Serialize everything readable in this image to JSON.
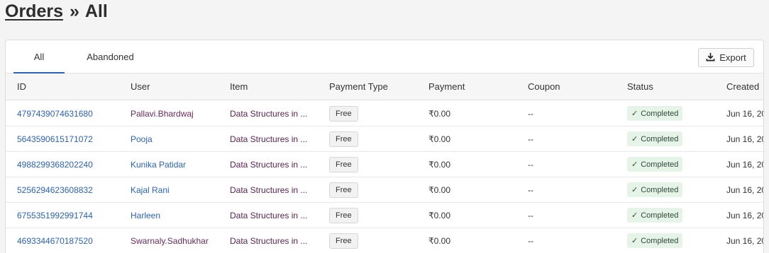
{
  "breadcrumb": {
    "parent": "Orders",
    "separator": "»",
    "current": "All"
  },
  "tabs": [
    {
      "label": "All",
      "active": true
    },
    {
      "label": "Abandoned",
      "active": false
    }
  ],
  "toolbar": {
    "export_label": "Export",
    "export_icon": "download-icon"
  },
  "columns": [
    "ID",
    "User",
    "Item",
    "Payment Type",
    "Payment",
    "Coupon",
    "Status",
    "Created"
  ],
  "rows": [
    {
      "id": "4797439074631680",
      "user": "Pallavi.Bhardwaj",
      "item": "Data Structures in ...",
      "payment_type": "Free",
      "payment": "₹0.00",
      "coupon": "--",
      "status": "Completed",
      "created": "Jun 16, 20"
    },
    {
      "id": "5643590615171072",
      "user": "Pooja",
      "item": "Data Structures in ...",
      "payment_type": "Free",
      "payment": "₹0.00",
      "coupon": "--",
      "status": "Completed",
      "created": "Jun 16, 20"
    },
    {
      "id": "4988299368202240",
      "user": "Kunika Patidar",
      "item": "Data Structures in ...",
      "payment_type": "Free",
      "payment": "₹0.00",
      "coupon": "--",
      "status": "Completed",
      "created": "Jun 16, 20"
    },
    {
      "id": "5256294623608832",
      "user": "Kajal Rani",
      "item": "Data Structures in ...",
      "payment_type": "Free",
      "payment": "₹0.00",
      "coupon": "--",
      "status": "Completed",
      "created": "Jun 16, 20"
    },
    {
      "id": "6755351992991744",
      "user": "Harleen",
      "item": "Data Structures in ...",
      "payment_type": "Free",
      "payment": "₹0.00",
      "coupon": "--",
      "status": "Completed",
      "created": "Jun 16, 20"
    },
    {
      "id": "4693344670187520",
      "user": "Swarnaly.Sadhukhar",
      "item": "Data Structures in ...",
      "payment_type": "Free",
      "payment": "₹0.00",
      "coupon": "--",
      "status": "Completed",
      "created": "Jun 16, 20"
    }
  ],
  "colors": {
    "link": "#2b63b8",
    "visited": "#5a2350",
    "status_bg": "#e6f4e8",
    "tab_accent": "#2b63b8"
  }
}
